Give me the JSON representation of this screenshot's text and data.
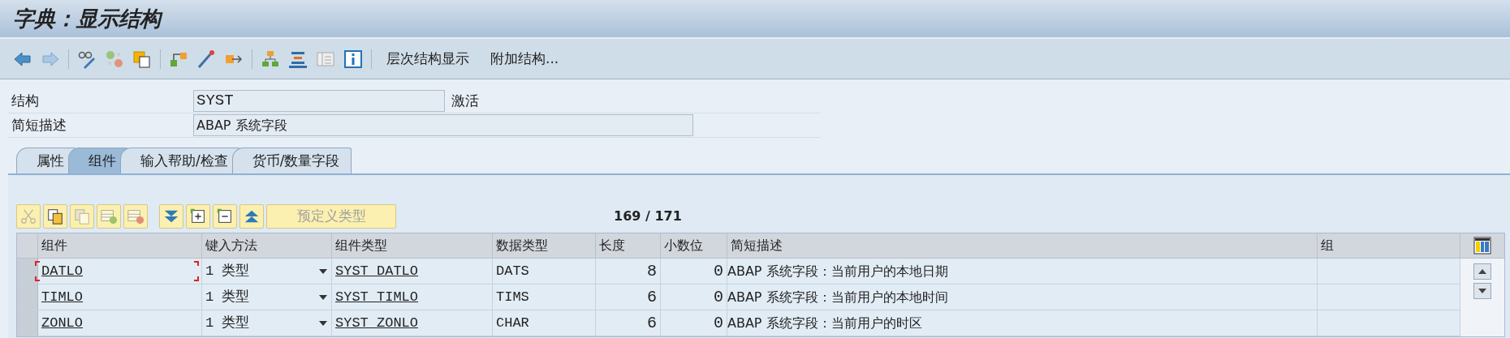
{
  "window": {
    "title": "字典：显示结构"
  },
  "toolbar": {
    "buttons": [
      "层次结构显示",
      "附加结构..."
    ]
  },
  "header_fields": [
    {
      "label": "结构",
      "value": "SYST",
      "status": "激活"
    },
    {
      "label": "简短描述",
      "value": "ABAP 系统字段"
    }
  ],
  "tabs": [
    {
      "label": "属性",
      "selected": false
    },
    {
      "label": "组件",
      "selected": true
    },
    {
      "label": "输入帮助/检查",
      "selected": false
    },
    {
      "label": "货币/数量字段",
      "selected": false
    }
  ],
  "table_toolbar": {
    "predefined_type_button": {
      "label": "预定义类型",
      "disabled": true
    },
    "counter": "169 / 171"
  },
  "table": {
    "columns": [
      "组件",
      "键入方法",
      "组件类型",
      "数据类型",
      "长度",
      "小数位",
      "简短描述",
      "组"
    ],
    "rows": [
      {
        "focused": true,
        "component": "DATLO",
        "typing_method": "1 类型",
        "component_type": "SYST_DATLO",
        "data_type": "DATS",
        "length": "8",
        "decimals": "0",
        "description": "ABAP 系统字段：当前用户的本地日期"
      },
      {
        "focused": false,
        "component": "TIMLO",
        "typing_method": "1 类型",
        "component_type": "SYST_TIMLO",
        "data_type": "TIMS",
        "length": "6",
        "decimals": "0",
        "description": "ABAP 系统字段：当前用户的本地时间"
      },
      {
        "focused": false,
        "component": "ZONLO",
        "typing_method": "1 类型",
        "component_type": "SYST_ZONLO",
        "data_type": "CHAR",
        "length": "6",
        "decimals": "0",
        "description": "ABAP 系统字段：当前用户的时区"
      }
    ]
  }
}
